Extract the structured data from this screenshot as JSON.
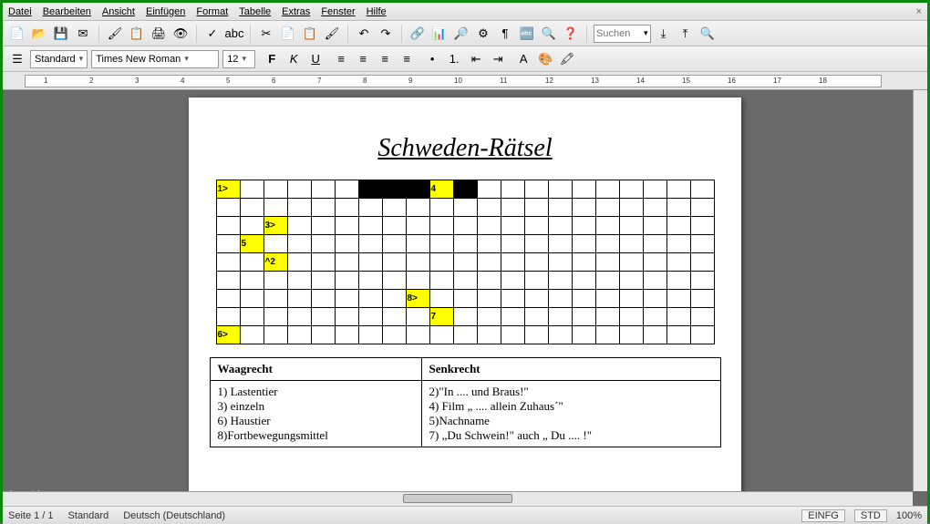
{
  "menu": {
    "items": [
      "Datei",
      "Bearbeiten",
      "Ansicht",
      "Einfügen",
      "Format",
      "Tabelle",
      "Extras",
      "Fenster",
      "Hilfe"
    ],
    "close": "×"
  },
  "toolbar": {
    "search_placeholder": "Suchen",
    "icons": [
      "📄",
      "📂",
      "💾",
      "✉",
      "🖌",
      "📋",
      "🖨",
      "👁",
      "✓",
      "abc",
      "✂",
      "📄",
      "📋",
      "🖌",
      "↶",
      "↷",
      "🔗",
      "📊",
      "🔎",
      "⚙",
      "¶",
      "🔤",
      "🔍",
      "❓"
    ]
  },
  "format": {
    "style": "Standard",
    "font": "Times New Roman",
    "size": "12",
    "buttons": [
      "F",
      "K",
      "U"
    ],
    "align": [
      "≡",
      "≡",
      "≡",
      "≡"
    ],
    "list": [
      "•",
      "1.",
      "⇤",
      "⇥"
    ],
    "color": [
      "A",
      "🎨",
      "🖍"
    ]
  },
  "ruler": {
    "marks": [
      "1",
      "2",
      "3",
      "4",
      "5",
      "6",
      "7",
      "8",
      "9",
      "10",
      "11",
      "12",
      "13",
      "14",
      "15",
      "16",
      "17",
      "18"
    ]
  },
  "document": {
    "title": "Schweden-Rätsel",
    "grid": {
      "rows": 9,
      "cols": 21,
      "cells": {
        "0,0": {
          "t": "1>",
          "c": "yellow"
        },
        "0,6": {
          "c": "black"
        },
        "0,7": {
          "c": "black"
        },
        "0,8": {
          "c": "black"
        },
        "0,9": {
          "t": "4",
          "c": "yellow"
        },
        "0,10": {
          "c": "black"
        },
        "2,2": {
          "t": "3>",
          "c": "yellow"
        },
        "3,1": {
          "t": "5",
          "c": "yellow"
        },
        "4,2": {
          "t": "^2",
          "c": "yellow"
        },
        "6,8": {
          "t": "8>",
          "c": "yellow"
        },
        "7,9": {
          "t": "7",
          "c": "yellow"
        },
        "8,0": {
          "t": "6>",
          "c": "yellow"
        }
      }
    },
    "clues": {
      "across_header": "Waagrecht",
      "down_header": "Senkrecht",
      "across": [
        "1) Lastentier",
        "3) einzeln",
        "6) Haustier",
        "8)Fortbewegungsmittel"
      ],
      "down": [
        "2)\"In .... und Braus!\"",
        "4) Film „ .... allein Zuhaus´\"",
        "5)Nachname",
        "7) „Du Schwein!\" auch „ Du .... !\""
      ]
    }
  },
  "watermark": "rlage Ideen",
  "status": {
    "page": "Seite 1 / 1",
    "style": "Standard",
    "lang": "Deutsch (Deutschland)",
    "ins": "EINFG",
    "std": "STD",
    "zoom": "100%"
  }
}
